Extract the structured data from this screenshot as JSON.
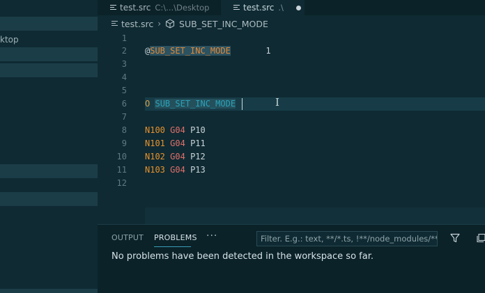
{
  "sidebar": {
    "desktop_fragment": "ktop"
  },
  "tabs": [
    {
      "name": "test.src",
      "description": "C:\\...\\Desktop",
      "active": false,
      "dirty": false
    },
    {
      "name": "test.src",
      "description": ".\\",
      "active": true,
      "dirty": true
    }
  ],
  "breadcrumb": {
    "file": "test.src",
    "symbol": "SUB_SET_INC_MODE"
  },
  "editor": {
    "lines": [
      {
        "number": "1",
        "text": ""
      },
      {
        "number": "2",
        "text": "@SUB_SET_INC_MODE      1"
      },
      {
        "number": "3",
        "text": ""
      },
      {
        "number": "4",
        "text": ""
      },
      {
        "number": "5",
        "text": ""
      },
      {
        "number": "6",
        "text": "O SUB_SET_INC_MODE"
      },
      {
        "number": "7",
        "text": ""
      },
      {
        "number": "8",
        "text": "N100 G04 P10"
      },
      {
        "number": "9",
        "text": "N101 G04 P11"
      },
      {
        "number": "10",
        "text": "N102 G04 P12"
      },
      {
        "number": "11",
        "text": "N103 G04 P13"
      },
      {
        "number": "12",
        "text": ""
      }
    ],
    "tokens": {
      "l2_at": "@",
      "l2_label": "SUB_SET_INC_MODE",
      "l2_num": "1",
      "l6_o": "O",
      "l6_sub": "SUB_SET_INC_MODE",
      "l8": [
        "N100",
        "G04",
        "P10"
      ],
      "l9": [
        "N101",
        "G04",
        "P11"
      ],
      "l10": [
        "N102",
        "G04",
        "P12"
      ],
      "l11": [
        "N103",
        "G04",
        "P13"
      ]
    }
  },
  "panel": {
    "tabs": [
      "OUTPUT",
      "PROBLEMS"
    ],
    "active_tab": "PROBLEMS",
    "more_label": "···",
    "filter_placeholder": "Filter. E.g.: text, **/*.ts, !**/node_modules/**",
    "message": "No problems have been detected in the workspace so far."
  },
  "colors": {
    "background": "#0f2a33",
    "accent": "#3a9fb5",
    "label": "#e08a3a",
    "gcode": "#e0706a"
  },
  "icons": [
    "file-icon",
    "chevron-right-icon",
    "symbol-cube-icon",
    "filter-icon",
    "collapse-panel-icon",
    "more-icon"
  ]
}
